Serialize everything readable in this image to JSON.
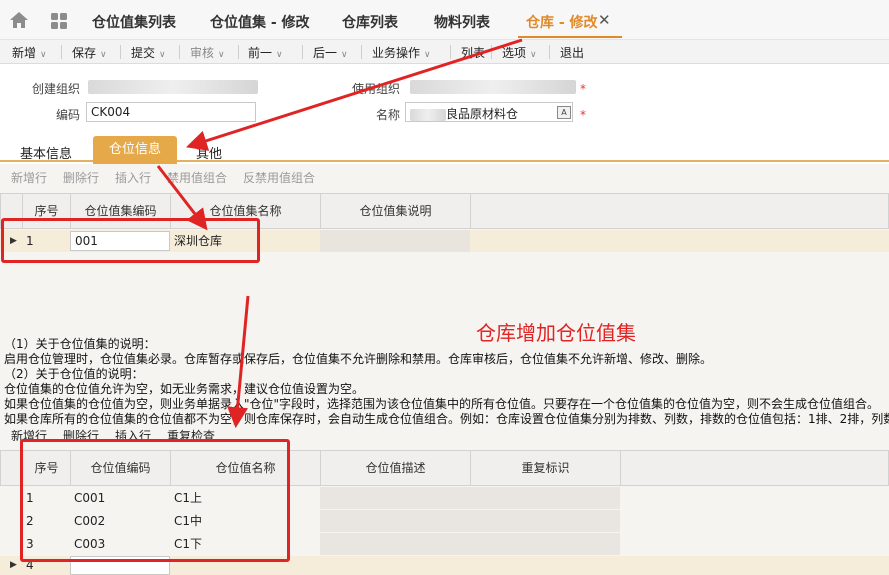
{
  "tabs": [
    {
      "label": "仓位值集列表"
    },
    {
      "label": "仓位值集 - 修改"
    },
    {
      "label": "仓库列表"
    },
    {
      "label": "物料列表"
    },
    {
      "label": "仓库 - 修改",
      "active": true
    }
  ],
  "toolbar": {
    "items": [
      "新增",
      "保存",
      "提交",
      "审核",
      "前一",
      "后一",
      "业务操作",
      "列表",
      "选项",
      "退出"
    ]
  },
  "form": {
    "create_org_label": "创建组织",
    "use_org_label": "使用组织",
    "code_label": "编码",
    "code_value": "CK004",
    "name_label": "名称",
    "name_value_suffix": "良品原材料仓"
  },
  "subtabs": [
    "基本信息",
    "仓位信息",
    "其他"
  ],
  "location_set_toolbar": [
    "新增行",
    "删除行",
    "插入行",
    "禁用值组合",
    "反禁用值组合"
  ],
  "location_set_grid": {
    "columns": [
      "序号",
      "仓位值集编码",
      "仓位值集名称",
      "仓位值集说明"
    ],
    "rows": [
      {
        "seq": "1",
        "code": "001",
        "name": "深圳仓库",
        "desc": ""
      }
    ]
  },
  "annotation": "仓库增加仓位值集",
  "notes": [
    "（1）关于仓位值集的说明：",
    "启用仓位管理时，仓位值集必录。仓库暂存或保存后，仓位值集不允许删除和禁用。仓库审核后，仓位值集不允许新增、修改、删除。",
    "（2）关于仓位值的说明：",
    "仓位值集的仓位值允许为空，如无业务需求，建议仓位值设置为空。",
    "如果仓位值集的仓位值为空，则业务单据录入\"仓位\"字段时，选择范围为该仓位值集中的所有仓位值。只要存在一个仓位值集的仓位值为空，则不会生成仓位值组合。",
    "如果仓库所有的仓位值集的仓位值都不为空，则仓库保存时，会自动生成仓位值组合。例如：仓库设置仓位值集分别为排数、列数，排数的仓位值包括：1排、2排，列数"
  ],
  "location_value_toolbar": [
    "新增行",
    "删除行",
    "插入行",
    "重复检查"
  ],
  "location_value_grid": {
    "columns": [
      "序号",
      "仓位值编码",
      "仓位值名称",
      "仓位值描述",
      "重复标识"
    ],
    "rows": [
      {
        "seq": "1",
        "code": "C001",
        "name": "C1上"
      },
      {
        "seq": "2",
        "code": "C002",
        "name": "C1中"
      },
      {
        "seq": "3",
        "code": "C003",
        "name": "C1下"
      },
      {
        "seq": "4",
        "code": "",
        "name": ""
      }
    ]
  },
  "colors": {
    "accent": "#e08a2a",
    "annotation": "#e02424",
    "tab_active_bg": "#e6a94a"
  }
}
